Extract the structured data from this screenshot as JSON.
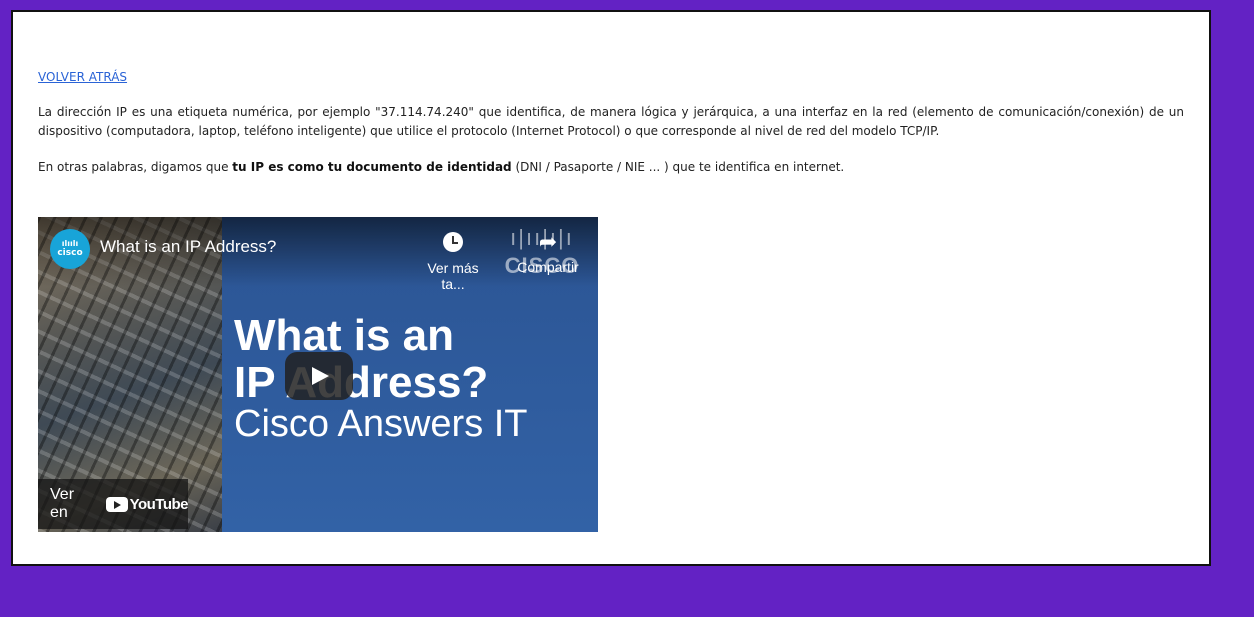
{
  "page": {
    "back_link": "VOLVER ATRÁS",
    "paragraph1": "La dirección IP es una etiqueta numérica, por ejemplo \"37.114.74.240\" que identifica, de manera lógica y jerárquica, a una interfaz en la red (elemento de comunicación/conexión) de un dispositivo (computadora, laptop, teléfono inteligente) que utilice el protocolo (Internet Protocol) o que corresponde al nivel de red del modelo TCP/IP.",
    "paragraph2_before": "En otras palabras, digamos que ",
    "paragraph2_bold": "tu IP es como tu documento de identidad",
    "paragraph2_after": " (DNI / Pasaporte / NIE ... ) que te identifica en internet."
  },
  "video": {
    "title": "What is an IP Address?",
    "watch_later": "Ver más ta...",
    "share": "Compartir",
    "channel_initial": "cisco",
    "watermark": "CISCO",
    "thumb_line1": "What is an",
    "thumb_line2": "IP Address?",
    "thumb_line3": "Cisco Answers IT",
    "watch_on": "Ver en",
    "youtube": "YouTube"
  },
  "colors": {
    "background": "#6322c4",
    "link": "#2a63d6",
    "thumb_blue": "#3262a6",
    "cisco_blue": "#18a4d8"
  },
  "icons": [
    "clock-icon",
    "share-icon",
    "play-icon",
    "youtube-logo",
    "cisco-logo"
  ]
}
